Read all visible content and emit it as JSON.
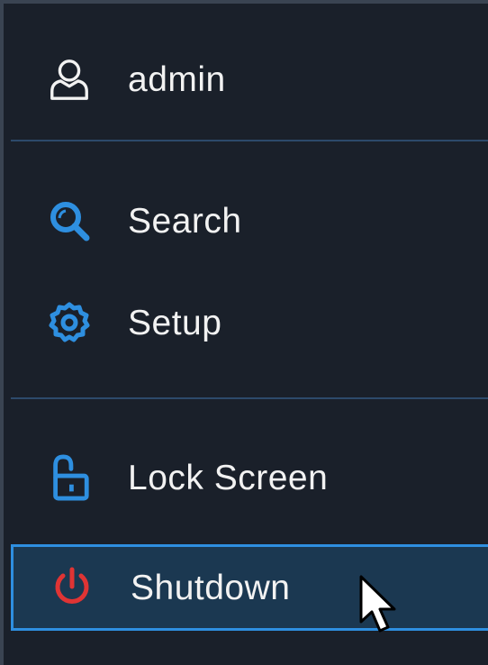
{
  "menu": {
    "user": {
      "label": "admin",
      "icon": "user-icon"
    },
    "items": [
      {
        "label": "Search",
        "icon": "search-icon"
      },
      {
        "label": "Setup",
        "icon": "gear-icon"
      },
      {
        "label": "Lock Screen",
        "icon": "unlock-icon"
      },
      {
        "label": "Shutdown",
        "icon": "power-icon",
        "selected": true
      }
    ]
  },
  "colors": {
    "background": "#1a202a",
    "accent": "#2e8fe0",
    "selected_bg": "#1b3851",
    "divider": "#2d4a6b",
    "power": "#e03434",
    "text": "#f2f2f2"
  }
}
